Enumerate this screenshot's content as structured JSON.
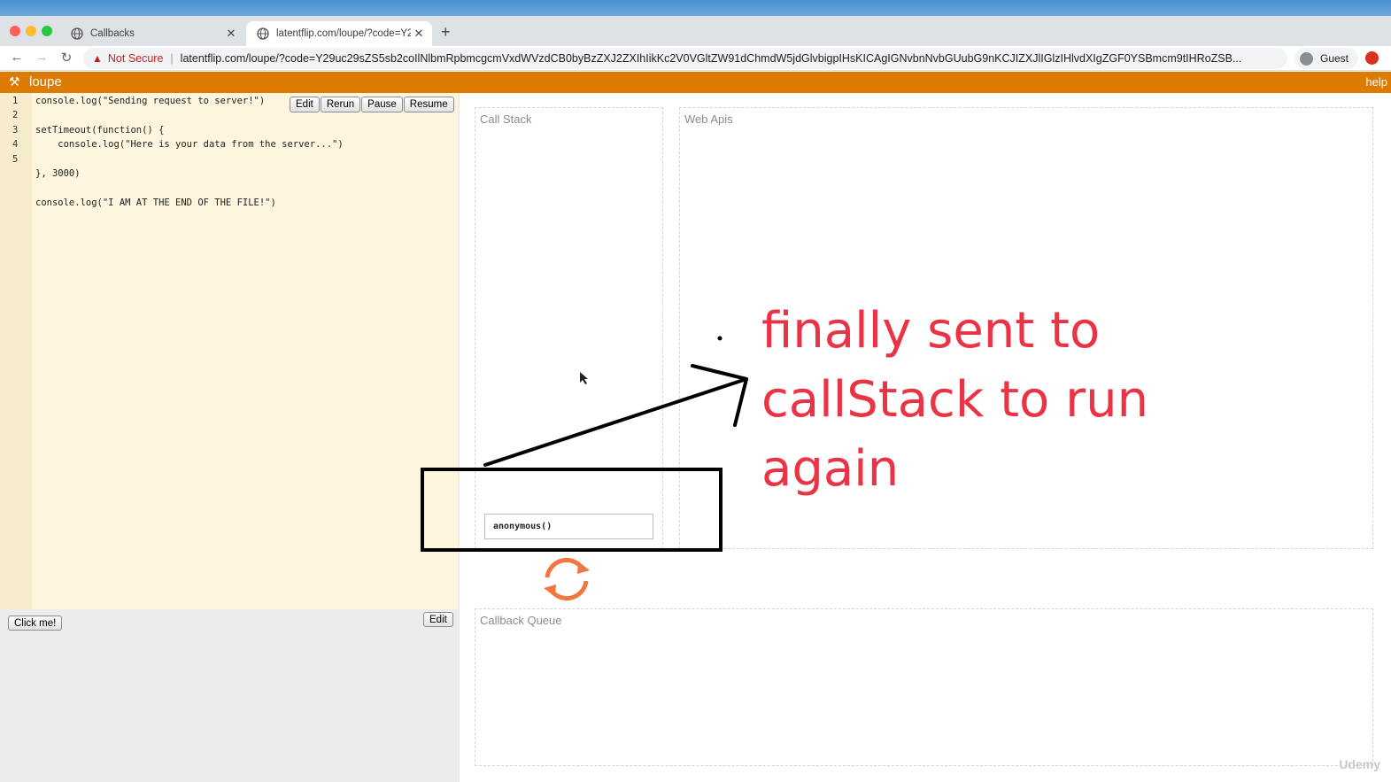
{
  "browser": {
    "tabs": [
      {
        "title": "Callbacks",
        "active": false
      },
      {
        "title": "latentflip.com/loupe/?code=Y2",
        "active": true
      }
    ],
    "new_tab_label": "+",
    "nav": {
      "back": "←",
      "forward": "→",
      "reload": "↻"
    },
    "security_label": "Not Secure",
    "url": "latentflip.com/loupe/?code=Y29uc29sZS5sb2coIlNlbmRpbmcgcmVxdWVzdCB0byBzZXJ2ZXIhIikKc2V0VGltZW91dChmdW5jdGlvbigpIHsKICAgIGNvbnNvbGUubG9nKCJIZXJlIGlzIHlvdXIgZGF0YSBmcm9tIHRoZSB...",
    "profile_label": "Guest",
    "colors": {
      "close": "#ff5f57",
      "minimize": "#febc2e",
      "maximize": "#28c840"
    }
  },
  "app": {
    "name": "loupe",
    "help": "help",
    "accent": "#dc7b00"
  },
  "editor": {
    "line_numbers": [
      "1",
      "2",
      "3",
      "4",
      "5"
    ],
    "code_lines": [
      "console.log(\"Sending request to server!\")",
      "",
      "setTimeout(function() {",
      "    console.log(\"Here is your data from the server...\")",
      "",
      "}, 3000)",
      "",
      "console.log(\"I AM AT THE END OF THE FILE!\")"
    ],
    "buttons": {
      "edit": "Edit",
      "rerun": "Rerun",
      "pause": "Pause",
      "resume": "Resume"
    }
  },
  "output": {
    "click_button": "Click me!",
    "edit_button": "Edit"
  },
  "panels": {
    "call_stack": "Call Stack",
    "web_apis": "Web Apis",
    "callback_queue": "Callback Queue"
  },
  "call_stack_frames": [
    "anonymous()"
  ],
  "annotation": {
    "lines": [
      "finally sent to",
      "callStack to run",
      "again"
    ],
    "color": "#ea3446"
  },
  "watermark": "Udemy"
}
